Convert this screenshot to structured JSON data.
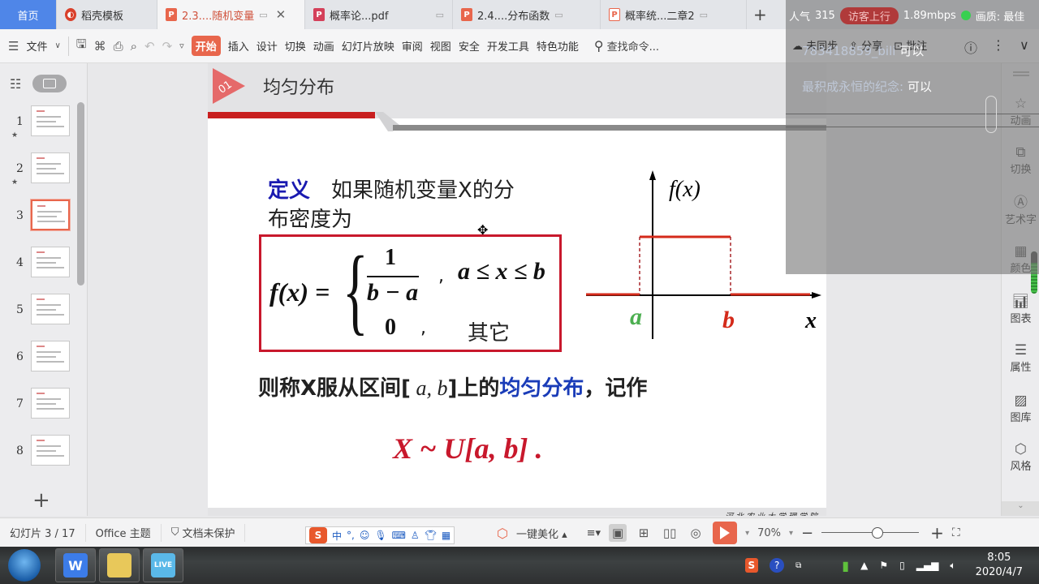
{
  "tabs": [
    {
      "label": "首页",
      "type": "home"
    },
    {
      "label": "稻壳模板",
      "icon": "docer-icon"
    },
    {
      "label": "2.3....随机变量",
      "icon": "ppt-icon",
      "active": true
    },
    {
      "label": "概率论...pdf",
      "icon": "pdf-icon"
    },
    {
      "label": "2.4....分布函数",
      "icon": "ppt-icon"
    },
    {
      "label": "概率统...二章2",
      "icon": "ppt-outline-icon"
    }
  ],
  "toolbar": {
    "file_menu": "文件",
    "ribbon": [
      "开始",
      "插入",
      "设计",
      "切换",
      "动画",
      "幻灯片放映",
      "审阅",
      "视图",
      "安全",
      "开发工具",
      "特色功能"
    ],
    "search_placeholder": "查找命令...",
    "cloud_sync": "未同步",
    "share": "分享",
    "comment": "批注"
  },
  "stream_overlay": {
    "popularity_label": "人气",
    "popularity_value": "315",
    "guest_button": "访客上行",
    "bitrate": "1.89mbps",
    "quality_label": "画质: 最佳",
    "messages": [
      {
        "name": "783418859_bili",
        "text": "可以"
      },
      {
        "name": "最积成永恒的纪念:",
        "text": "可以"
      }
    ]
  },
  "thumbnails": {
    "items": [
      {
        "num": "1",
        "starred": true
      },
      {
        "num": "2",
        "starred": true
      },
      {
        "num": "3",
        "selected": true
      },
      {
        "num": "4"
      },
      {
        "num": "5"
      },
      {
        "num": "6"
      },
      {
        "num": "7"
      },
      {
        "num": "8"
      }
    ]
  },
  "slide": {
    "badge_num": "01",
    "title": "均匀分布",
    "def_label": "定义",
    "def_line1": "如果随机变量X的分",
    "def_line2": "布密度为",
    "formula": {
      "lhs": "f(x) =",
      "numerator": "1",
      "denominator": "b − a",
      "comma": ",",
      "case1_cond": "a ≤ x ≤ b",
      "case2_value": "0",
      "case2_cond": "其它"
    },
    "graph": {
      "y_label": "f(x)",
      "x_label": "x",
      "a_label": "a",
      "b_label": "b",
      "colors": {
        "density": "#d42a1a",
        "a": "#4caf50",
        "b": "#d42a1a"
      }
    },
    "conclusion_pre": "则称X服从区间[",
    "conclusion_interval": " a, b",
    "conclusion_mid": "]上的",
    "conclusion_term": "均匀分布",
    "conclusion_post": "，记作",
    "notation": "X ~ U[a, b] .",
    "footer": "河北农业大学理学院"
  },
  "right_sidebar": [
    {
      "label": "动画",
      "icon": "star-icon"
    },
    {
      "label": "切换",
      "icon": "transition-icon"
    },
    {
      "label": "艺术字",
      "icon": "wordart-icon"
    },
    {
      "label": "颜色",
      "icon": "color-grid-icon"
    },
    {
      "label": "图表",
      "icon": "chart-icon"
    },
    {
      "label": "属性",
      "icon": "sliders-icon"
    },
    {
      "label": "图库",
      "icon": "image-icon"
    },
    {
      "label": "风格",
      "icon": "style-icon"
    }
  ],
  "statusbar": {
    "slide_counter": "幻灯片 3 / 17",
    "theme": "Office 主题",
    "protection": "文档未保护",
    "beautify": "一键美化",
    "zoom": "70%",
    "zoom_fraction": 0.58,
    "ime_mode": "中"
  },
  "taskbar": {
    "apps": [
      "wps-office",
      "file-explorer",
      "bilibili-live"
    ],
    "time": "8:05",
    "date": "2020/4/7"
  }
}
